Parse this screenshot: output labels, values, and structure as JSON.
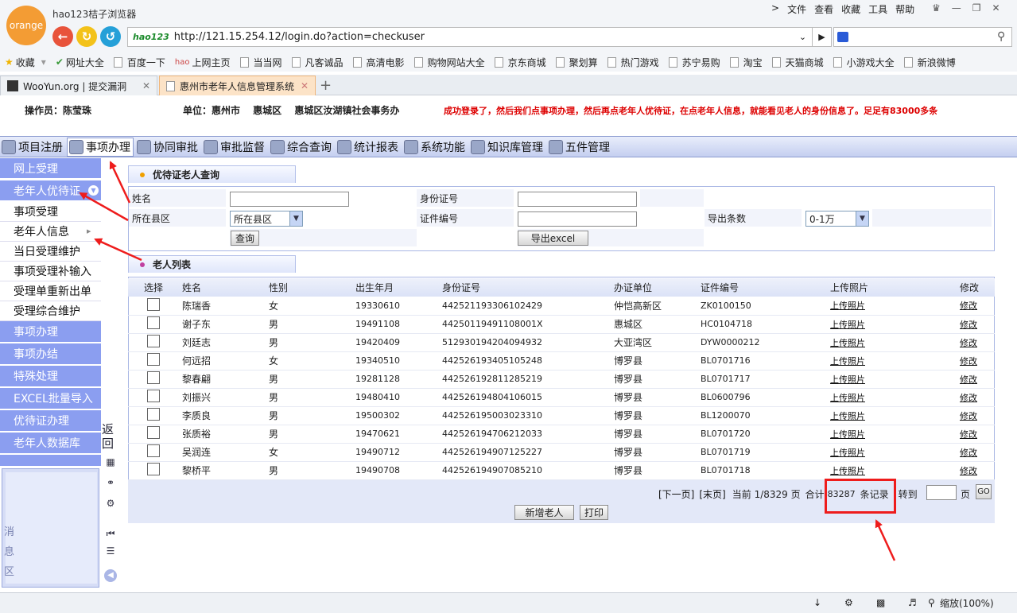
{
  "browser": {
    "logo_text": "orange",
    "app_name": "hao123桔子浏览器",
    "url": "http://121.15.254.12/login.do?action=checkuser",
    "hao_label": "hao123",
    "menu": [
      "文件",
      "查看",
      "收藏",
      "工具",
      "帮助"
    ],
    "bookmarks": [
      "收藏",
      "网址大全",
      "百度一下",
      "上网主页",
      "当当网",
      "凡客诚品",
      "高清电影",
      "购物网站大全",
      "京东商城",
      "聚划算",
      "热门游戏",
      "苏宁易购",
      "淘宝",
      "天猫商城",
      "小游戏大全",
      "新浪微博"
    ],
    "tabs": [
      {
        "label": "WooYun.org | 提交漏洞"
      },
      {
        "label": "惠州市老年人信息管理系统"
      }
    ],
    "zoom_label": "缩放(100%)"
  },
  "header": {
    "operator": "操作员：陈莹珠",
    "unit": "单位：惠州市　 惠城区　 惠城区汝湖镇社会事务办",
    "notice": "成功登录了，然后我们点事项办理，然后再点老年人优待证，在点老年人信息，就能看见老人的身份信息了。足足有83000多条"
  },
  "modules": [
    "项目注册",
    "事项办理",
    "协同审批",
    "审批监督",
    "综合查询",
    "统计报表",
    "系统功能",
    "知识库管理",
    "五件管理"
  ],
  "active_module": "事项办理",
  "sidebar": {
    "items": [
      {
        "label": "网上受理",
        "type": "head"
      },
      {
        "label": "老年人优待证",
        "type": "head"
      },
      {
        "label": "事项受理",
        "type": "sub"
      },
      {
        "label": "老年人信息",
        "type": "sub"
      },
      {
        "label": "当日受理维护",
        "type": "sub"
      },
      {
        "label": "事项受理补输入",
        "type": "sub"
      },
      {
        "label": "受理单重新出单",
        "type": "sub"
      },
      {
        "label": "受理综合维护",
        "type": "sub"
      },
      {
        "label": "事项办理",
        "type": "head"
      },
      {
        "label": "事项办结",
        "type": "head"
      },
      {
        "label": "特殊处理",
        "type": "head"
      },
      {
        "label": "EXCEL批量导入",
        "type": "head"
      },
      {
        "label": "优待证办理",
        "type": "head"
      },
      {
        "label": "老年人数据库",
        "type": "head"
      }
    ],
    "message_label": "消息区",
    "back_label": "返回"
  },
  "query": {
    "section_title": "优待证老人查询",
    "name_label": "姓名",
    "id_label": "身份证号",
    "county_label": "所在县区",
    "county_value": "所在县区",
    "cert_label": "证件编号",
    "export_count_label": "导出条数",
    "export_count_value": "0-1万",
    "search_button": "查询",
    "export_button": "导出excel"
  },
  "list": {
    "section_title": "老人列表",
    "columns": [
      "选择",
      "姓名",
      "性别",
      "出生年月",
      "身份证号",
      "办证单位",
      "证件编号",
      "上传照片",
      "修改"
    ],
    "rows": [
      [
        "陈瑞香",
        "女",
        "19330610",
        "442521193306102429",
        "仲恺高新区",
        "ZK0100150",
        "上传照片",
        "修改"
      ],
      [
        "谢子东",
        "男",
        "19491108",
        "44250119491108001X",
        "惠城区",
        "HC0104718",
        "上传照片",
        "修改"
      ],
      [
        "刘廷志",
        "男",
        "19420409",
        "512930194204094932",
        "大亚湾区",
        "DYW0000212",
        "上传照片",
        "修改"
      ],
      [
        "何远招",
        "女",
        "19340510",
        "442526193405105248",
        "博罗县",
        "BL0701716",
        "上传照片",
        "修改"
      ],
      [
        "黎春翩",
        "男",
        "19281128",
        "442526192811285219",
        "博罗县",
        "BL0701717",
        "上传照片",
        "修改"
      ],
      [
        "刘振兴",
        "男",
        "19480410",
        "442526194804106015",
        "博罗县",
        "BL0600796",
        "上传照片",
        "修改"
      ],
      [
        "李质良",
        "男",
        "19500302",
        "442526195003023310",
        "博罗县",
        "BL1200070",
        "上传照片",
        "修改"
      ],
      [
        "张质裕",
        "男",
        "19470621",
        "442526194706212033",
        "博罗县",
        "BL0701720",
        "上传照片",
        "修改"
      ],
      [
        "吴润连",
        "女",
        "19490712",
        "442526194907125227",
        "博罗县",
        "BL0701719",
        "上传照片",
        "修改"
      ],
      [
        "黎桥平",
        "男",
        "19490708",
        "442526194907085210",
        "博罗县",
        "BL0701718",
        "上传照片",
        "修改"
      ]
    ],
    "pager": {
      "next": "[下一页]",
      "last": "[末页]",
      "current": "当前 1/8329 页",
      "total_prefix": "合计",
      "total_count": "83287",
      "total_suffix": "条记录",
      "goto_label": "转到",
      "page_unit": "页",
      "go_button": "GO"
    },
    "add_button": "新增老人",
    "print_button": "打印"
  },
  "colors": {
    "accent": "#8b9ef0",
    "annotation_red": "#ee1c1c",
    "notice_red": "#dd0000",
    "logo_orange": "#f39c34"
  }
}
